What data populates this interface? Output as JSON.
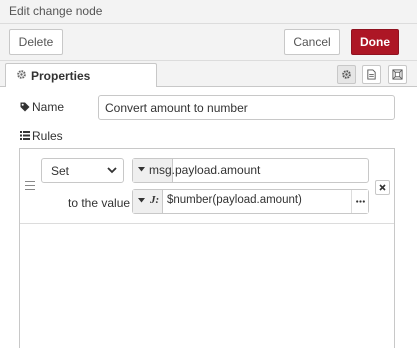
{
  "title": "Edit change node",
  "buttons": {
    "delete": "Delete",
    "cancel": "Cancel",
    "done": "Done"
  },
  "tabs": {
    "properties": "Properties"
  },
  "form": {
    "name_label": "Name",
    "name_value": "Convert amount to number",
    "rules_label": "Rules"
  },
  "rule": {
    "action": "Set",
    "target_type": "msg.",
    "target_value": "payload.amount",
    "to_label": "to the value",
    "value_type_icon": "J:",
    "value_expression": "$number(payload.amount)"
  },
  "icons": {
    "properties_tab": "gear-icon",
    "tab_settings": "gear-icon",
    "tab_description": "document-icon",
    "tab_appearance": "frame-icon",
    "name": "tag-icon",
    "rules": "list-icon",
    "remove": "close-icon",
    "expand": "ellipsis-icon"
  },
  "colors": {
    "done_button": "#ad1625"
  }
}
